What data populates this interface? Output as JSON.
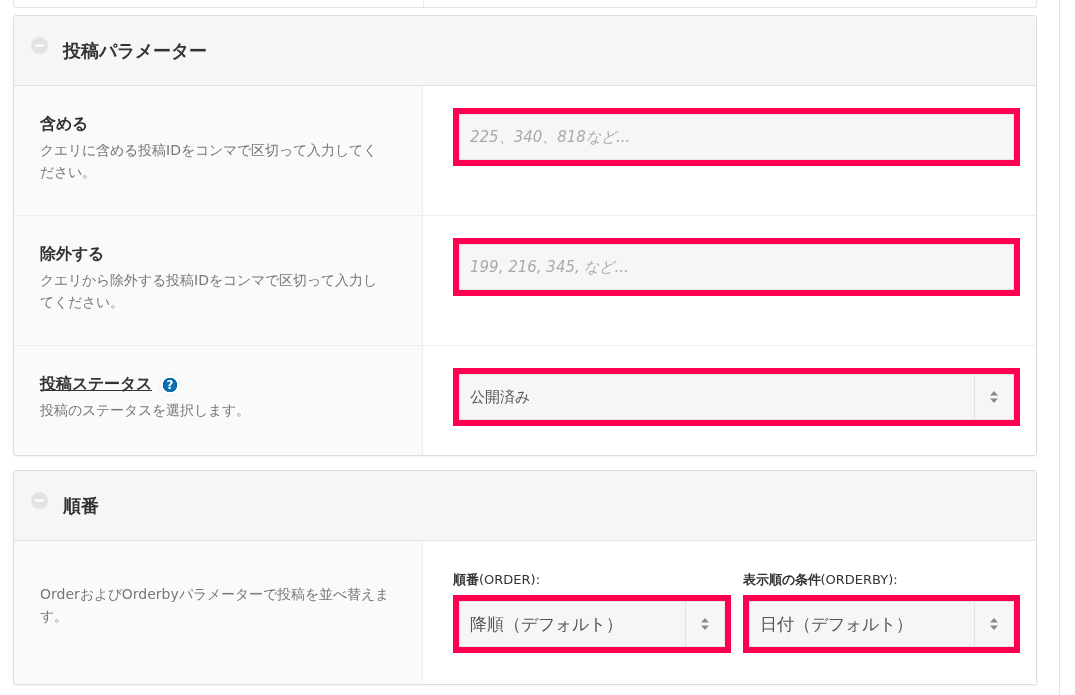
{
  "panels": [
    {
      "title": "投稿パラメーター",
      "expanded": true,
      "rows": [
        {
          "label": "含める",
          "underlined": false,
          "description": "クエリに含める投稿IDをコンマで区切って入力してください。",
          "field": {
            "kind": "text",
            "placeholder": "225、340、818など...",
            "highlighted": true
          }
        },
        {
          "label": "除外する",
          "underlined": false,
          "description": "クエリから除外する投稿IDをコンマで区切って入力してください。",
          "field": {
            "kind": "text",
            "placeholder": "199, 216, 345, など...",
            "highlighted": true
          }
        },
        {
          "label": "投稿ステータス",
          "underlined": true,
          "help": "?",
          "description": "投稿のステータスを選択します。",
          "field": {
            "kind": "select",
            "value": "公開済み",
            "highlighted": true
          }
        }
      ]
    },
    {
      "title": "順番",
      "expanded": true,
      "order": {
        "description": "OrderおよびOrderbyパラメーターで投稿を並べ替えます。",
        "selects": [
          {
            "label": "**順番**(ORDER):",
            "value": "降順（デフォルト）",
            "highlighted": true
          },
          {
            "label": "**表示順の条件**(ORDERBY):",
            "value": "日付（デフォルト）",
            "highlighted": true
          }
        ]
      }
    }
  ]
}
